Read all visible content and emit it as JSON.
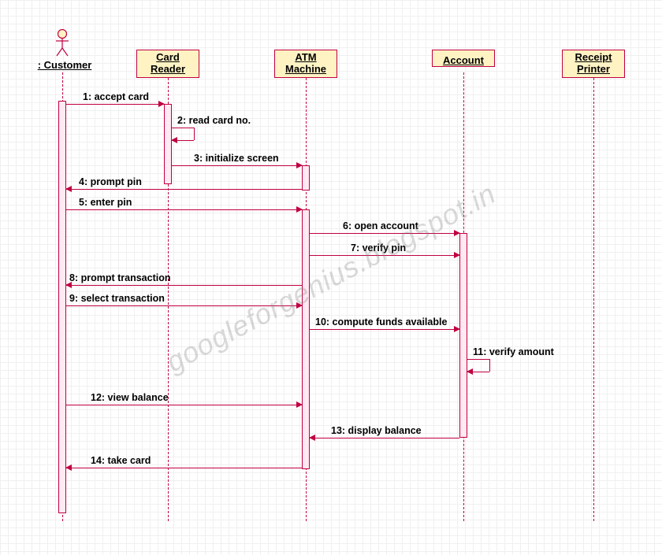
{
  "diagram_type": "UML Sequence Diagram",
  "actor": {
    "name": ": Customer"
  },
  "lifelines": [
    {
      "id": "card_reader",
      "label": "Card\nReader"
    },
    {
      "id": "atm_machine",
      "label": "ATM\nMachine"
    },
    {
      "id": "account",
      "label": "Account"
    },
    {
      "id": "receipt_printer",
      "label": "Receipt\nPrinter"
    }
  ],
  "messages": [
    {
      "n": 1,
      "text": "1: accept card"
    },
    {
      "n": 2,
      "text": "2: read card no."
    },
    {
      "n": 3,
      "text": "3: initialize screen"
    },
    {
      "n": 4,
      "text": "4: prompt pin"
    },
    {
      "n": 5,
      "text": "5: enter pin"
    },
    {
      "n": 6,
      "text": "6: open account"
    },
    {
      "n": 7,
      "text": "7: verify pin"
    },
    {
      "n": 8,
      "text": "8: prompt transaction"
    },
    {
      "n": 9,
      "text": "9: select transaction"
    },
    {
      "n": 10,
      "text": "10: compute funds available"
    },
    {
      "n": 11,
      "text": "11: verify amount"
    },
    {
      "n": 12,
      "text": "12: view balance"
    },
    {
      "n": 13,
      "text": "13: display balance"
    },
    {
      "n": 14,
      "text": "14: take card"
    }
  ],
  "watermark": "googleforgenius.blogspot.in"
}
